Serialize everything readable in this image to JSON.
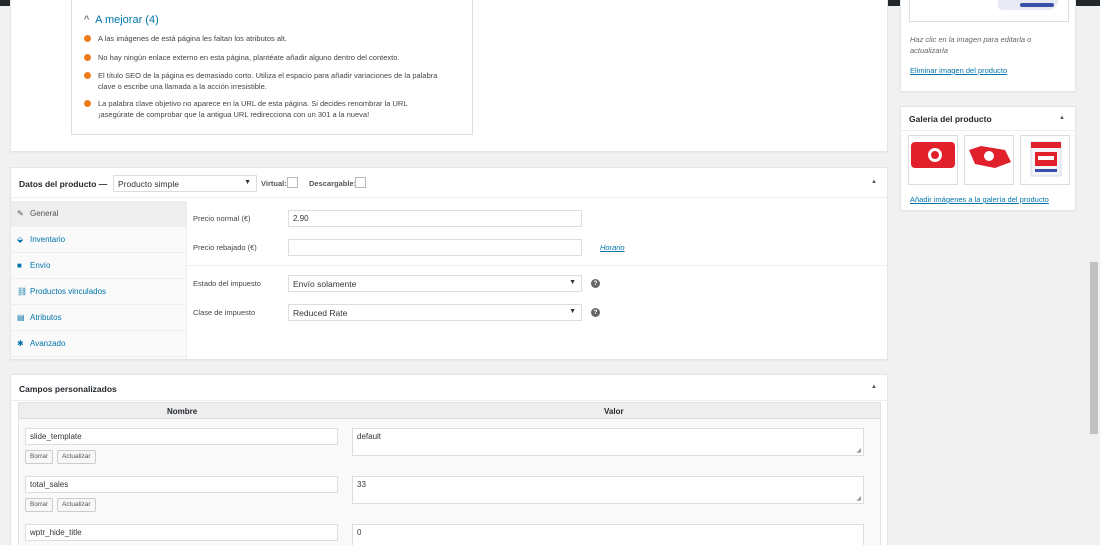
{
  "seo": {
    "heading": "A mejorar (4)",
    "items": [
      "A las imágenes de está página les faltan los atributos alt.",
      "No hay ningún enlace externo en esta página, plantéate añadir alguno dentro del contexto.",
      "El título SEO de la página es demasiado corto. Utiliza el espacio para añadir variaciones de la palabra clave o escribe una llamada a la acción irresistible.",
      "La palabra clave objetivo no aparece en la URL de esta página. Si decides renombrar la URL ¡asegúrate de comprobar que la antigua URL redirecciona con un 301 a la nueva!"
    ]
  },
  "product_data": {
    "title": "Datos del producto —",
    "type_select": "Producto simple",
    "virtual_label": "Virtual:",
    "downloadable_label": "Descargable:",
    "tabs": [
      "General",
      "Inventario",
      "Envío",
      "Productos vinculados",
      "Atributos",
      "Avanzado"
    ],
    "regular_price_label": "Precio normal (€)",
    "regular_price_value": "2.90",
    "sale_price_label": "Precio rebajado (€)",
    "sale_price_value": "",
    "schedule_link": "Horario",
    "tax_status_label": "Estado del impuesto",
    "tax_status_value": "Envío solamente",
    "tax_class_label": "Clase de impuesto",
    "tax_class_value": "Reduced Rate"
  },
  "custom_fields": {
    "title": "Campos personalizados",
    "col_name": "Nombre",
    "col_value": "Valor",
    "delete_label": "Borrar",
    "update_label": "Actualizar",
    "rows": [
      {
        "name": "slide_template",
        "value": "default"
      },
      {
        "name": "total_sales",
        "value": "33"
      },
      {
        "name": "wptr_hide_title",
        "value": "0"
      }
    ]
  },
  "product_image": {
    "hint": "Haz clic en la imagen para editarla o actualizarla",
    "remove_link": "Eliminar imagen del producto"
  },
  "gallery": {
    "title": "Galería del producto",
    "add_link": "Añadir imágenes a la galería del producto"
  },
  "icons": {
    "toggle": "triangle-up-icon",
    "help": "help-icon",
    "select_arrow": "chevron-down-icon"
  },
  "colors": {
    "accent": "#0073aa",
    "warning": "#ee7c1b",
    "brand_red": "#e0202b"
  }
}
